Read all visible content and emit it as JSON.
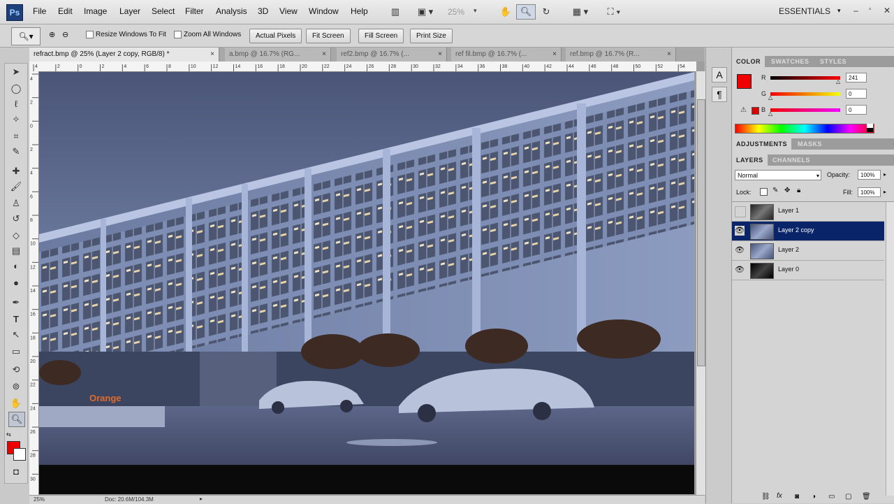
{
  "app": {
    "logo": "Ps"
  },
  "menu": [
    "File",
    "Edit",
    "Image",
    "Layer",
    "Select",
    "Filter",
    "Analysis",
    "3D",
    "View",
    "Window",
    "Help"
  ],
  "appbar": {
    "zoom": "25%",
    "workspace": "ESSENTIALS"
  },
  "options": {
    "resize_windows": "Resize Windows To Fit",
    "zoom_all": "Zoom All Windows",
    "buttons": [
      "Actual Pixels",
      "Fit Screen",
      "Fill Screen",
      "Print Size"
    ]
  },
  "tabs": [
    {
      "label": "refract.bmp @ 25% (Layer 2 copy, RGB/8) *",
      "active": true
    },
    {
      "label": "a.bmp @ 16.7% (RG...",
      "active": false
    },
    {
      "label": "ref2.bmp @ 16.7% (...",
      "active": false
    },
    {
      "label": "ref fil.bmp @ 16.7% (...",
      "active": false
    },
    {
      "label": "ref.bmp @ 16.7% (R...",
      "active": false
    }
  ],
  "ruler_top": [
    "4",
    "2",
    "0",
    "2",
    "4",
    "6",
    "8",
    "10",
    "12",
    "14",
    "16",
    "18",
    "20",
    "22",
    "24",
    "26",
    "28",
    "30",
    "32",
    "34",
    "36",
    "38",
    "40",
    "42",
    "44",
    "46",
    "48",
    "50",
    "52",
    "54"
  ],
  "ruler_left": [
    "4",
    "2",
    "0",
    "2",
    "4",
    "6",
    "8",
    "10",
    "12",
    "14",
    "16",
    "18",
    "20",
    "22",
    "24",
    "26",
    "28",
    "30"
  ],
  "status": {
    "zoom": "25%",
    "doc": "Doc: 20.6M/104.3M"
  },
  "canvas": {
    "signage": "Orange"
  },
  "color_panel": {
    "tabs": [
      "COLOR",
      "SWATCHES",
      "STYLES"
    ],
    "r_label": "R",
    "g_label": "G",
    "b_label": "B",
    "r": "241",
    "g": "0",
    "b": "0",
    "foreground": "#f10000"
  },
  "adjust_tabs": [
    "ADJUSTMENTS",
    "MASKS"
  ],
  "layers_panel": {
    "tabs": [
      "LAYERS",
      "CHANNELS"
    ],
    "blend_mode": "Normal",
    "opacity_label": "Opacity:",
    "opacity": "100%",
    "lock_label": "Lock:",
    "fill_label": "Fill:",
    "fill": "100%",
    "layers": [
      {
        "name": "Layer 1",
        "visible": false,
        "selected": false
      },
      {
        "name": "Layer 2 copy",
        "visible": true,
        "selected": true
      },
      {
        "name": "Layer 2",
        "visible": true,
        "selected": false
      },
      {
        "name": "Layer 0",
        "visible": true,
        "selected": false
      }
    ]
  }
}
